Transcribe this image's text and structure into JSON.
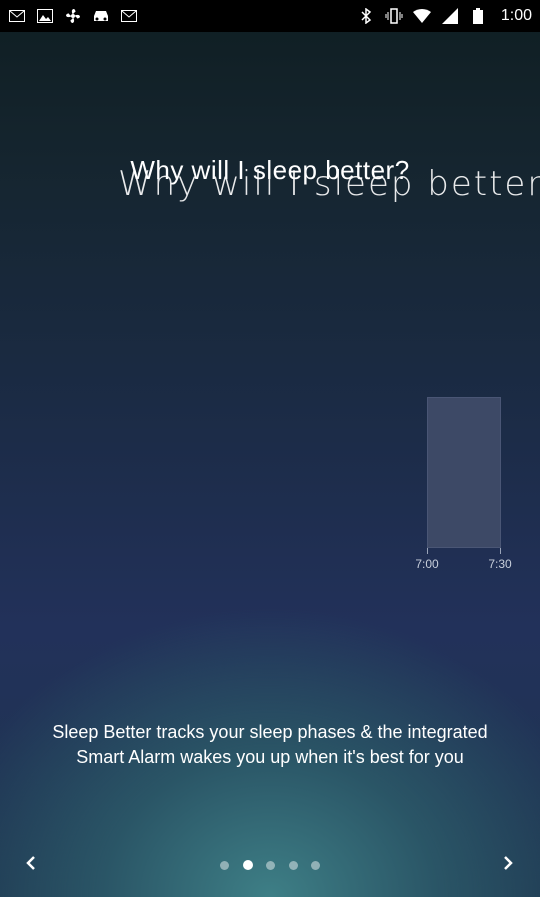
{
  "status_bar": {
    "time": "1:00",
    "icons": [
      "mail-icon",
      "image-icon",
      "fan-icon",
      "car-icon",
      "mail-icon",
      "bluetooth-icon",
      "vibrate-icon",
      "wifi-icon",
      "signal-icon",
      "battery-icon"
    ]
  },
  "header": {
    "title": "Why will I sleep better?",
    "title_ghost": "Why will I sleep better"
  },
  "chart": {
    "ticks": [
      "7:00",
      "7:30"
    ]
  },
  "description": "Sleep Better tracks your sleep phases & the integrated Smart Alarm wakes you up when it's best for you",
  "pager": {
    "total": 5,
    "active_index": 1
  },
  "colors": {
    "bar": "#3d4966",
    "accent": "#3e7f86"
  }
}
